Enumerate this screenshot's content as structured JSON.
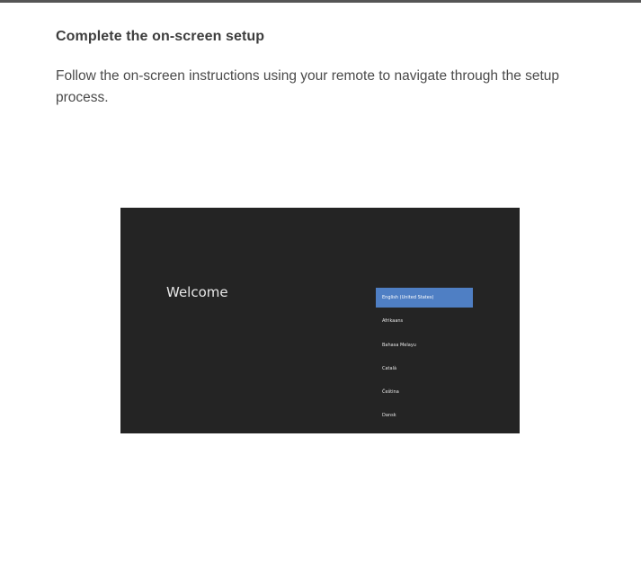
{
  "instruction": {
    "heading": "Complete the on-screen setup",
    "body": "Follow the on-screen instructions using your remote to navigate through the setup process."
  },
  "tv_screen": {
    "welcome_text": "Welcome",
    "selected_index": 0,
    "languages": [
      "English (United States)",
      "Afrikaans",
      "Bahasa Melayu",
      "Català",
      "Čeština",
      "Dansk"
    ],
    "colors": {
      "screen_background": "#242424",
      "selection_highlight": "#4f7fc4"
    }
  }
}
